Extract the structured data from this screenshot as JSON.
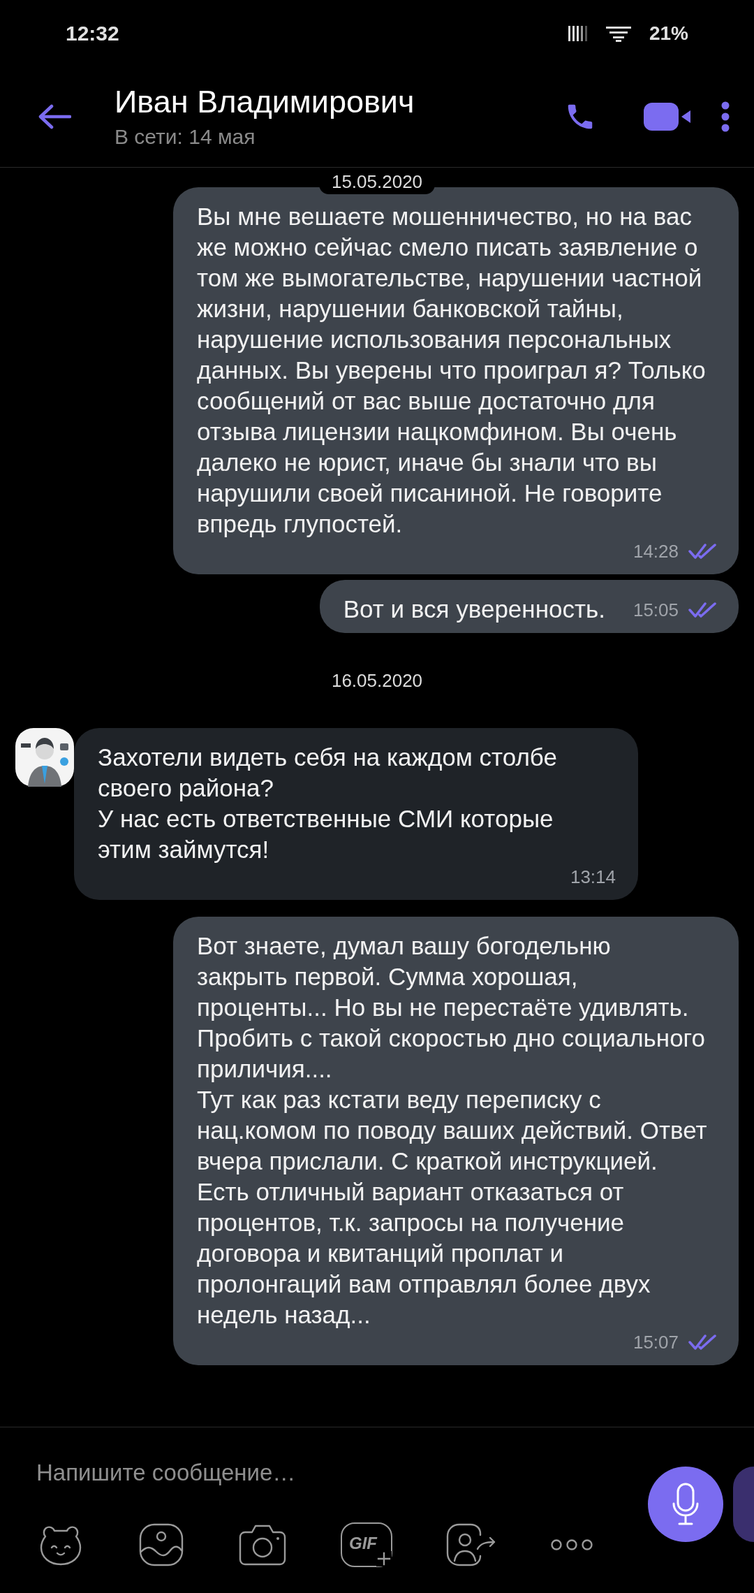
{
  "status_bar": {
    "time": "12:32",
    "battery": "21%"
  },
  "header": {
    "title": "Иван Владимирович",
    "subtitle": "В сети: 14 мая"
  },
  "messages": [
    {
      "kind": "date",
      "text": "15.05.2020"
    },
    {
      "kind": "outgoing",
      "text": "Вы мне вешаете мошенничество, но на вас же можно сейчас смело писать заявление о том же вымогательстве, нарушении частной жизни, нарушении банковской тайны, нарушение использования персональных данных. Вы уверены что проиграл я? Только сообщений от вас выше достаточно для отзыва лицензии нацкомфином. Вы очень далеко не юрист, иначе бы знали что вы нарушили своей писаниной. Не говорите впредь глупостей.",
      "time": "14:28",
      "read": true
    },
    {
      "kind": "outgoing",
      "text": "Вот и вся уверенность.",
      "time": "15:05",
      "read": true
    },
    {
      "kind": "date",
      "text": "16.05.2020"
    },
    {
      "kind": "incoming",
      "text": "Захотели видеть себя на каждом столбе своего района?\nУ нас есть ответственные СМИ которые этим займутся!",
      "time": "13:14"
    },
    {
      "kind": "outgoing",
      "text": "Вот знаете, думал вашу богодельню закрыть первой. Сумма хорошая, проценты... Но вы не перестаёте удивлять. Пробить с такой скоростью дно социального приличия....\nТут как раз кстати веду переписку с нац.комом по поводу ваших действий. Ответ вчера прислали. С краткой инструкцией. Есть отличный вариант отказаться от процентов, т.к. запросы на получение договора и квитанций проплат и пролонгаций вам отправлял более двух недель назад...",
      "time": "15:07",
      "read": true
    }
  ],
  "composer": {
    "placeholder": "Напишите сообщение…",
    "gif_label": "GIF"
  }
}
